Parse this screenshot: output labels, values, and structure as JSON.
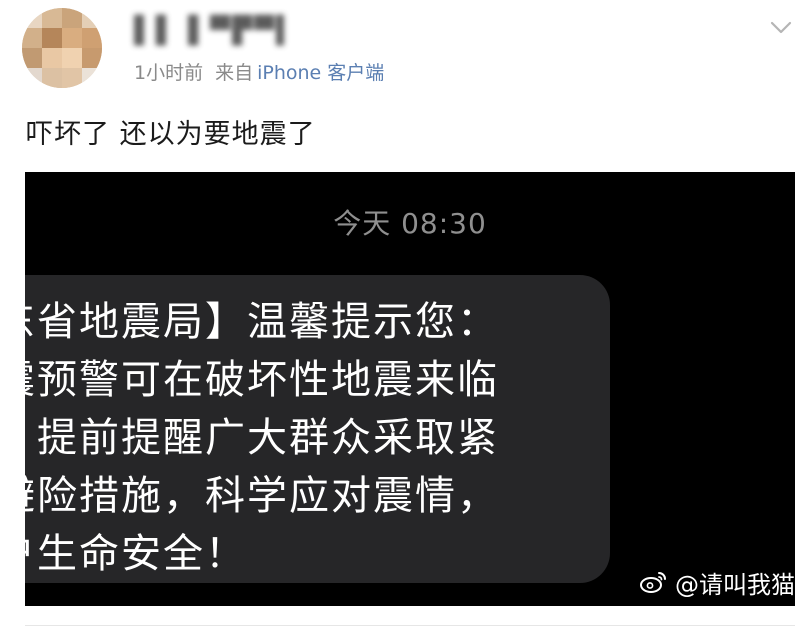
{
  "post": {
    "username": "▌▌ ▌▀▛▀▙",
    "time": "1小时前",
    "source_prefix": "来自",
    "source_client": "iPhone 客户端",
    "text": "吓坏了 还以为要地震了"
  },
  "screenshot": {
    "sms_time": "今天 08:30",
    "message_lines": [
      "东省地震局】温馨提示您：",
      "震预警可在破坏性地震来临",
      "，提前提醒广大群众采取紧",
      "避险措施，科学应对震情，",
      "户生命安全！"
    ],
    "watermark_text": "@请叫我猫"
  },
  "icons": {
    "menu": "chevron-down-icon",
    "watermark": "weibo-logo-icon"
  },
  "colors": {
    "source_client": "#5b7fb2",
    "bubble": "#262628",
    "screenshot_bg": "#000000",
    "sms_time": "#8f8f8f"
  }
}
